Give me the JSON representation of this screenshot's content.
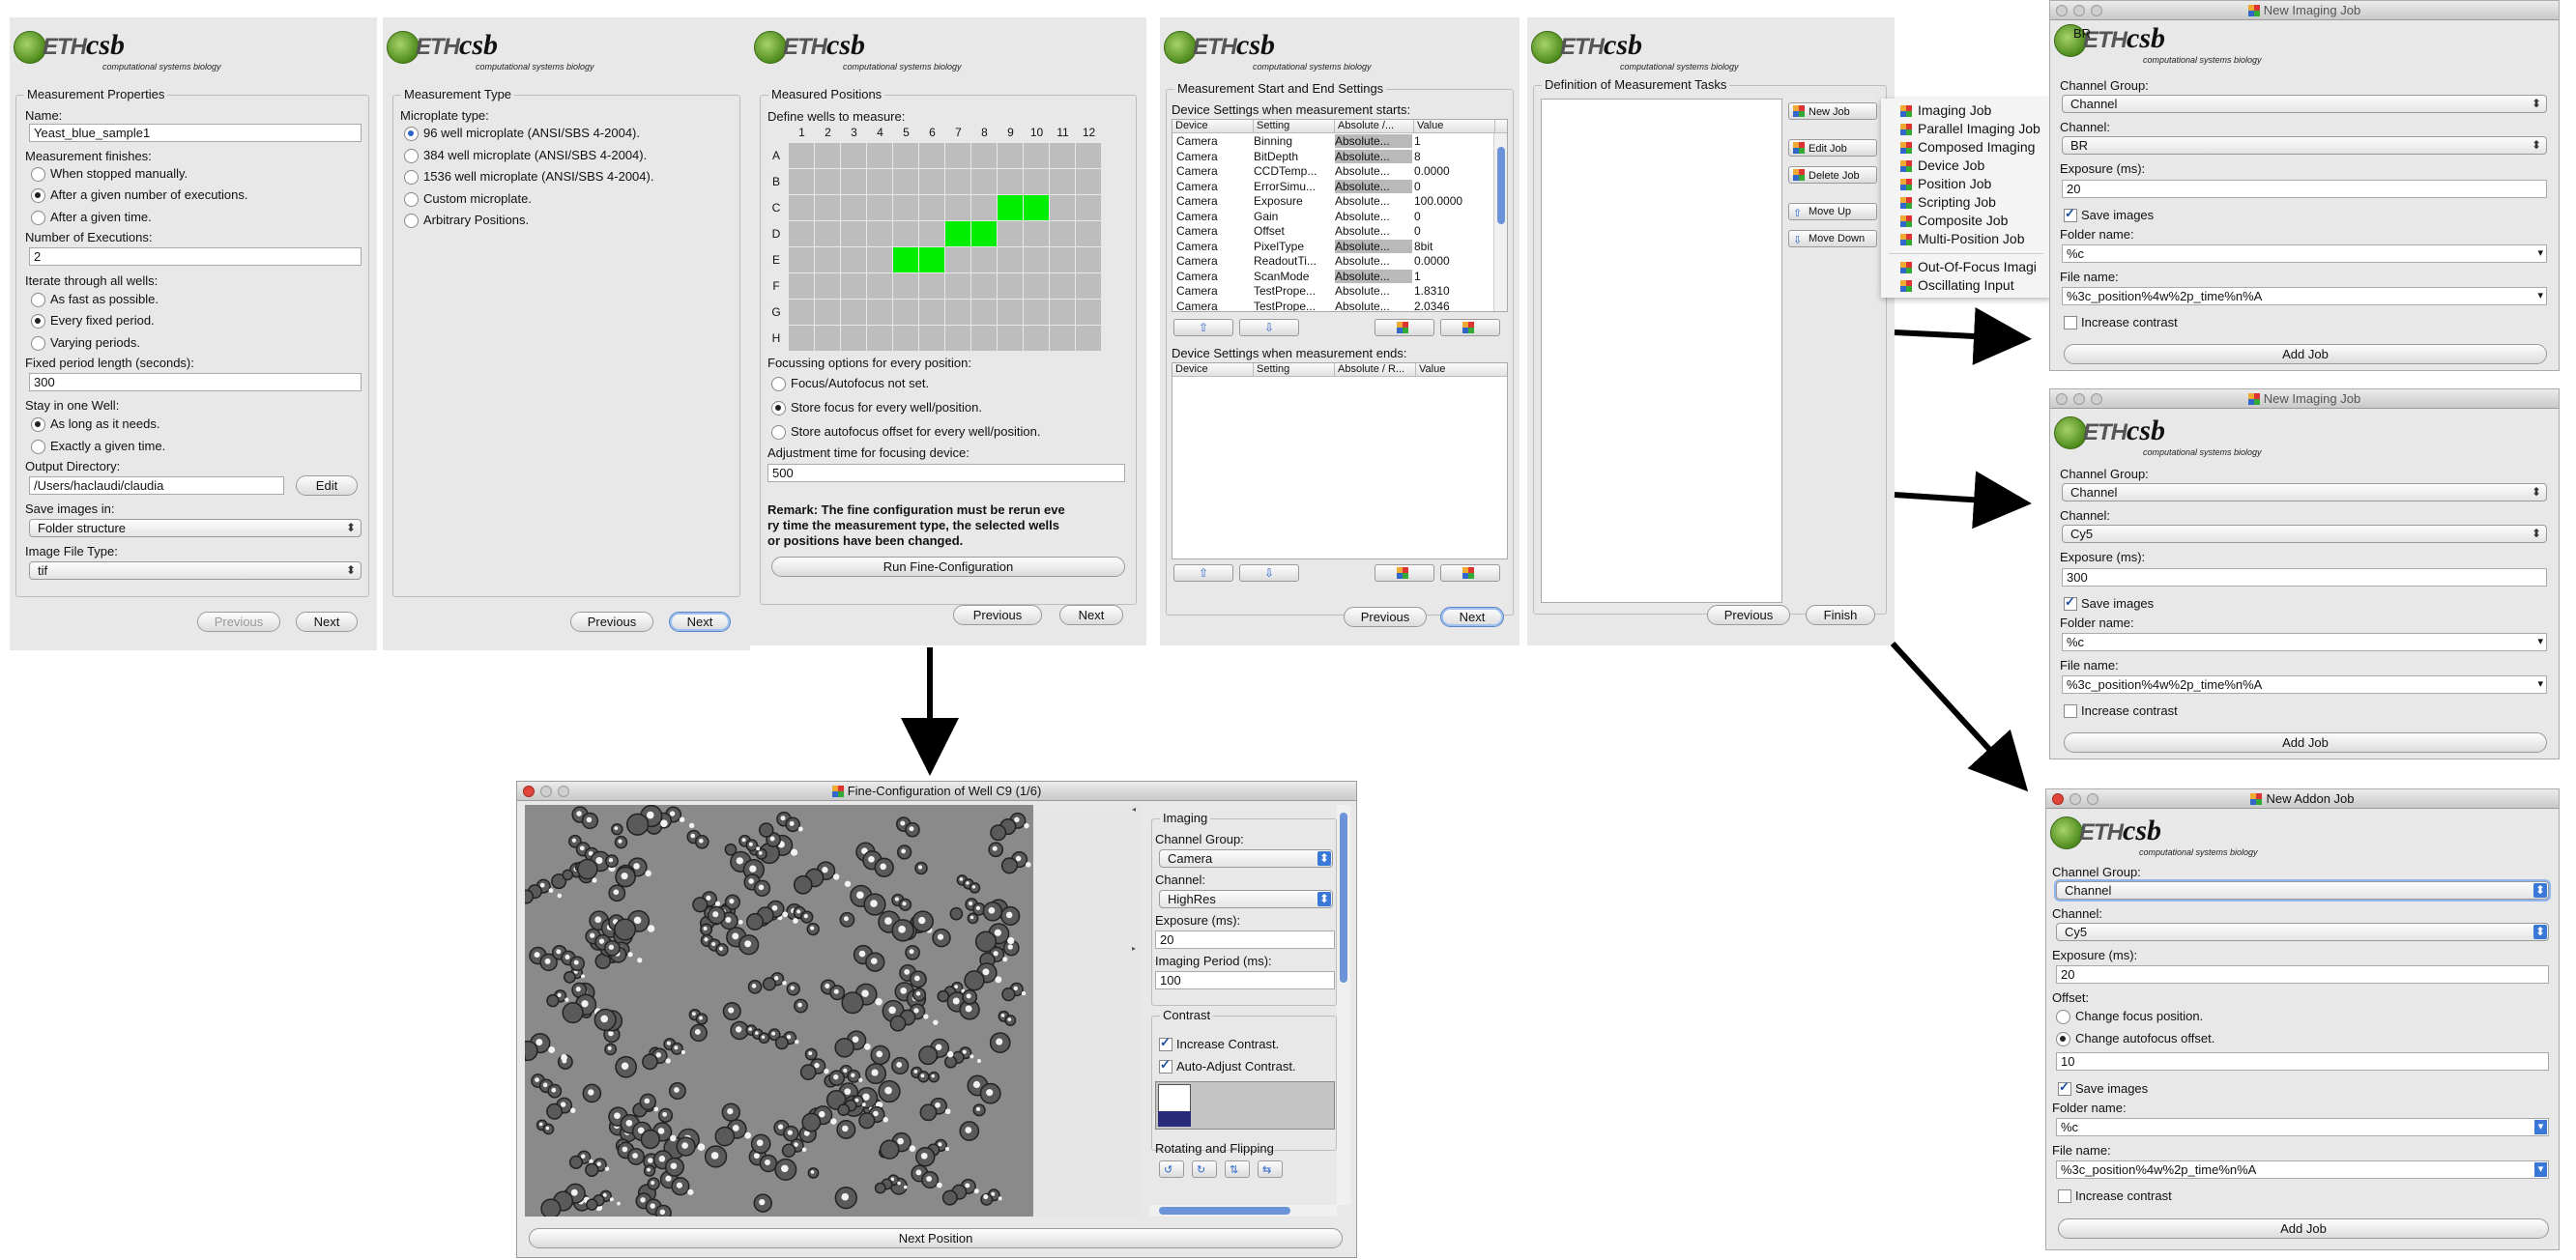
{
  "logo": {
    "eth": "ETH",
    "csb": "csb",
    "subtitle": "computational systems biology"
  },
  "p1": {
    "group_title": "Measurement Properties",
    "name_label": "Name:",
    "name_value": "Yeast_blue_sample1",
    "finishes_label": "Measurement finishes:",
    "finish_opts": [
      "When stopped manually.",
      "After a given number of executions.",
      "After a given time."
    ],
    "exec_label": "Number of Executions:",
    "exec_value": "2",
    "iterate_label": "Iterate through all wells:",
    "iterate_opts": [
      "As fast as possible.",
      "Every fixed period.",
      "Varying periods."
    ],
    "period_label": "Fixed period length (seconds):",
    "period_value": "300",
    "stay_label": "Stay in one Well:",
    "stay_opts": [
      "As long as it needs.",
      "Exactly a given time."
    ],
    "outdir_label": "Output Directory:",
    "outdir_value": "/Users/haclaudi/claudia",
    "edit": "Edit",
    "save_label": "Save images in:",
    "save_value": "Folder structure",
    "filetype_label": "Image File Type:",
    "filetype_value": "tif",
    "previous": "Previous",
    "next": "Next"
  },
  "p2": {
    "group_title": "Measurement Type",
    "type_label": "Microplate type:",
    "opts": [
      "96 well microplate (ANSI/SBS 4-2004).",
      "384 well microplate (ANSI/SBS 4-2004).",
      "1536 well microplate (ANSI/SBS 4-2004).",
      "Custom microplate.",
      "Arbitrary Positions."
    ],
    "previous": "Previous",
    "next": "Next"
  },
  "p3": {
    "group_title": "Measured Positions",
    "define_label": "Define wells to measure:",
    "cols": [
      "1",
      "2",
      "3",
      "4",
      "5",
      "6",
      "7",
      "8",
      "9",
      "10",
      "11",
      "12"
    ],
    "rows": [
      "A",
      "B",
      "C",
      "D",
      "E",
      "F",
      "G",
      "H"
    ],
    "selected": [
      [
        2,
        8
      ],
      [
        2,
        9
      ],
      [
        3,
        6
      ],
      [
        3,
        7
      ],
      [
        4,
        4
      ],
      [
        4,
        5
      ]
    ],
    "select_color": "#00ee00",
    "focus_label": "Focussing options for every position:",
    "focus_opts": [
      "Focus/Autofocus not set.",
      "Store focus for every well/position.",
      "Store autofocus offset for every well/position."
    ],
    "adjust_label": "Adjustment time for focusing device:",
    "adjust_value": "500",
    "remark": "Remark: The fine configuration must be rerun every time the measurement type, the selected wells or positions have been changed.",
    "remark_lines": [
      "Remark: The fine configuration must be rerun eve",
      "ry time the measurement type, the selected wells",
      "or positions have been changed."
    ],
    "run": "Run Fine-Configuration",
    "previous": "Previous",
    "next": "Next"
  },
  "p4": {
    "group_title": "Measurement Start and End Settings",
    "start_label": "Device Settings when measurement starts:",
    "headers": [
      "Device",
      "Setting",
      "Absolute /...",
      "Value"
    ],
    "rows": [
      [
        "Camera",
        "Binning",
        "Absolute...",
        "1"
      ],
      [
        "Camera",
        "BitDepth",
        "Absolute...",
        "8"
      ],
      [
        "Camera",
        "CCDTemp...",
        "Absolute...",
        "0.0000"
      ],
      [
        "Camera",
        "ErrorSimu...",
        "Absolute...",
        "0"
      ],
      [
        "Camera",
        "Exposure",
        "Absolute...",
        "100.0000"
      ],
      [
        "Camera",
        "Gain",
        "Absolute...",
        "0"
      ],
      [
        "Camera",
        "Offset",
        "Absolute...",
        "0"
      ],
      [
        "Camera",
        "PixelType",
        "Absolute...",
        "8bit"
      ],
      [
        "Camera",
        "ReadoutTi...",
        "Absolute...",
        "0.0000"
      ],
      [
        "Camera",
        "ScanMode",
        "Absolute...",
        "1"
      ],
      [
        "Camera",
        "TestPrope...",
        "Absolute...",
        "1.8310"
      ],
      [
        "Camera",
        "TestPrope...",
        "Absolute...",
        "2.0346"
      ]
    ],
    "end_label": "Device Settings when measurement ends:",
    "end_headers": [
      "Device",
      "Setting",
      "Absolute / R...",
      "Value"
    ],
    "previous": "Previous",
    "next": "Next"
  },
  "p5": {
    "group_title": "Definition of Measurement Tasks",
    "buttons": [
      "New Job",
      "Edit Job",
      "Delete Job",
      "Move Up",
      "Move Down"
    ],
    "menu": [
      "Imaging Job",
      "Parallel Imaging Job",
      "Composed Imaging",
      "Device Job",
      "Position Job",
      "Scripting Job",
      "Composite Job",
      "Multi-Position Job",
      "Out-Of-Focus Imagi",
      "Oscillating Input"
    ],
    "previous": "Previous",
    "finish": "Finish"
  },
  "fine": {
    "title": "Fine-Configuration of Well C9 (1/6)",
    "imaging": "Imaging",
    "cg_label": "Channel Group:",
    "cg_value": "Camera",
    "ch_label": "Channel:",
    "ch_value": "HighRes",
    "exp_label": "Exposure (ms):",
    "exp_value": "20",
    "period_label": "Imaging Period (ms):",
    "period_value": "100",
    "contrast": "Contrast",
    "inc": "Increase Contrast.",
    "auto": "Auto-Adjust Contrast.",
    "rot": "Rotating and Flipping",
    "next_pos": "Next Position"
  },
  "job1": {
    "title": "New Imaging Job",
    "overlay": "BR",
    "cg_label": "Channel Group:",
    "cg_value": "Channel",
    "ch_label": "Channel:",
    "ch_value": "BR",
    "exp_label": "Exposure (ms):",
    "exp_value": "20",
    "save": "Save images",
    "folder_label": "Folder name:",
    "folder_value": "%c",
    "file_label": "File name:",
    "file_value": "%3c_position%4w%2p_time%n%A",
    "contrast": "Increase contrast",
    "add": "Add Job"
  },
  "job2": {
    "title": "New Imaging Job",
    "cg_label": "Channel Group:",
    "cg_value": "Channel",
    "ch_label": "Channel:",
    "ch_value": "Cy5",
    "exp_label": "Exposure (ms):",
    "exp_value": "300",
    "save": "Save images",
    "folder_label": "Folder name:",
    "folder_value": "%c",
    "file_label": "File name:",
    "file_value": "%3c_position%4w%2p_time%n%A",
    "contrast": "Increase contrast",
    "add": "Add Job"
  },
  "job3": {
    "title": "New Addon Job",
    "cg_label": "Channel Group:",
    "cg_value": "Channel",
    "ch_label": "Channel:",
    "ch_value": "Cy5",
    "exp_label": "Exposure (ms):",
    "exp_value": "20",
    "offset_label": "Offset:",
    "offset_opts": [
      "Change focus position.",
      "Change autofocus offset."
    ],
    "offset_value": "10",
    "save": "Save images",
    "folder_label": "Folder name:",
    "folder_value": "%c",
    "file_label": "File name:",
    "file_value": "%3c_position%4w%2p_time%n%A",
    "contrast": "Increase contrast",
    "add": "Add Job"
  }
}
